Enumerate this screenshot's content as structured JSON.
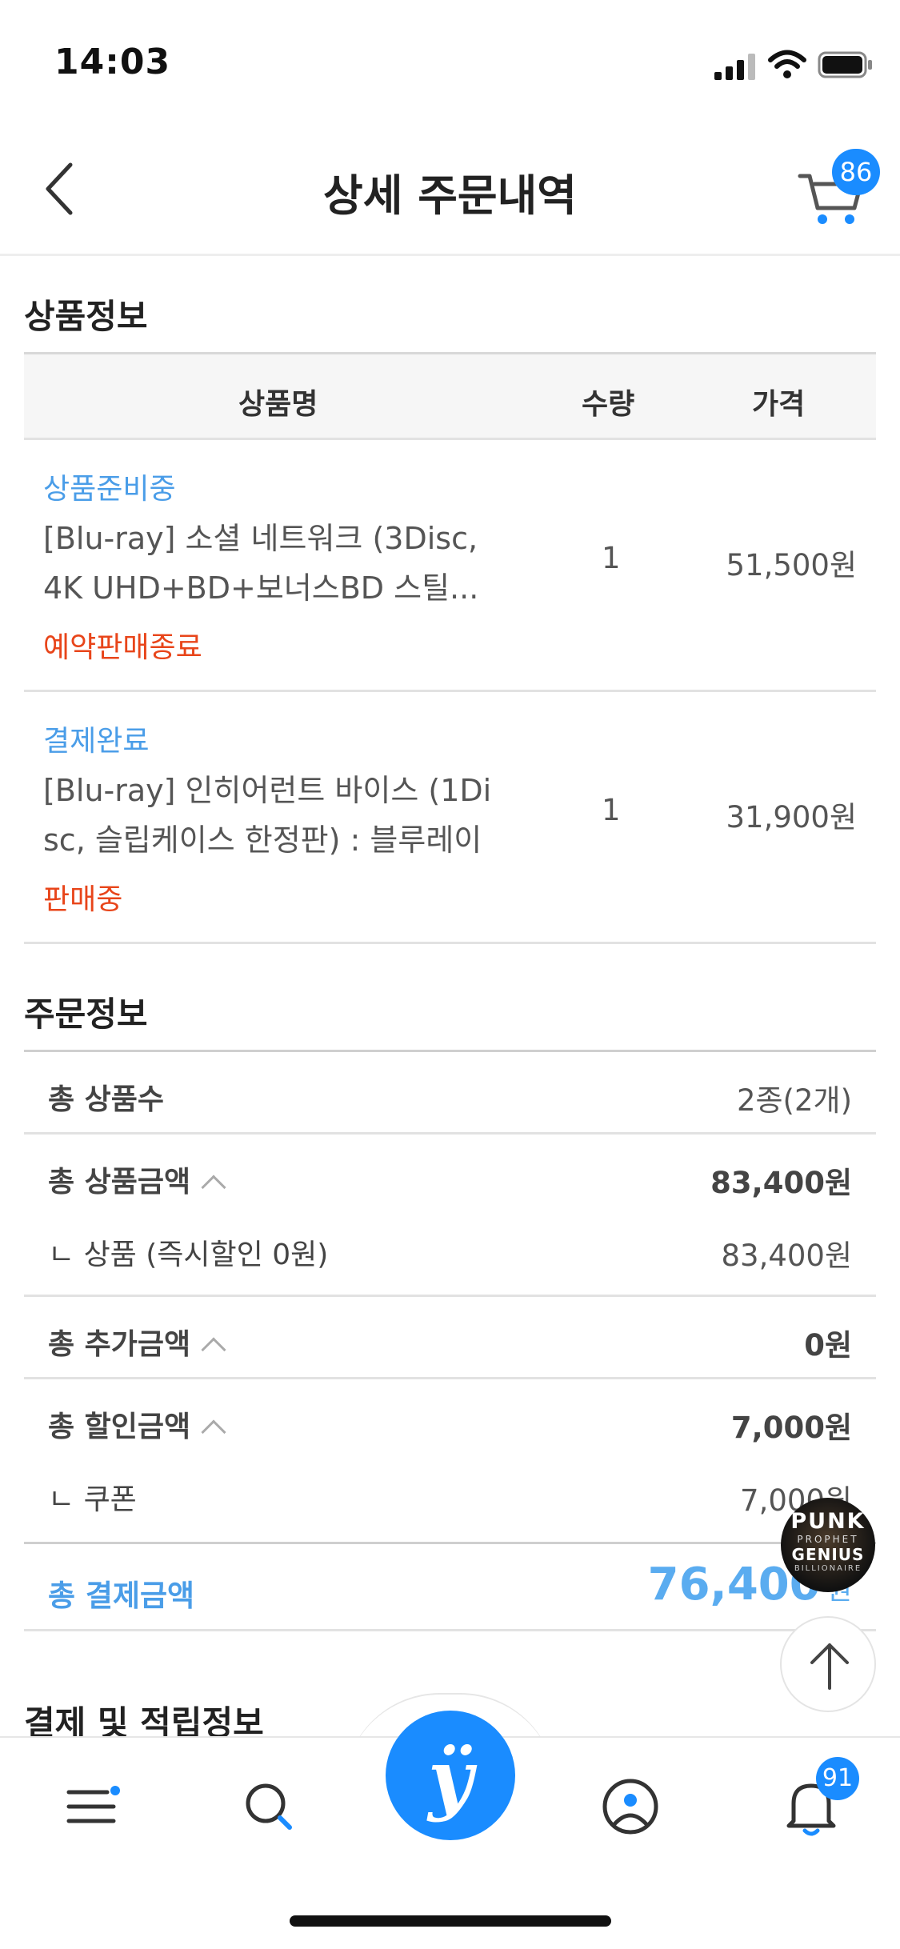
{
  "status_bar": {
    "time": "14:03"
  },
  "header": {
    "title": "상세 주문내역",
    "cart_count": "86"
  },
  "product_section": {
    "title": "상품정보",
    "columns": [
      "상품명",
      "수량",
      "가격"
    ],
    "items": [
      {
        "status": "상품준비중",
        "name_line1": "[Blu-ray] 소셜 네트워크 (3Disc,",
        "name_line2": "4K UHD+BD+보너스BD 스틸...",
        "sale_status": "예약판매종료",
        "qty": "1",
        "price": "51,500원"
      },
      {
        "status": "결제완료",
        "name_line1": "[Blu-ray] 인히어런트 바이스 (1Di",
        "name_line2": "sc, 슬립케이스 한정판) : 블루레이",
        "sale_status": "판매중",
        "qty": "1",
        "price": "31,900원"
      }
    ]
  },
  "order_section": {
    "title": "주문정보",
    "total_items_label": "총 상품수",
    "total_items_value": "2종(2개)",
    "product_amount_label": "총 상품금액",
    "product_amount_value": "83,400원",
    "product_sub_label": "ㄴ 상품 (즉시할인 0원)",
    "product_sub_value": "83,400원",
    "extra_amount_label": "총 추가금액",
    "extra_amount_value": "0원",
    "discount_label": "총 할인금액",
    "discount_value": "7,000원",
    "coupon_label": "ㄴ 쿠폰",
    "coupon_value": "7,000원",
    "payment_label": "총 결제금액",
    "payment_value": "76,400",
    "payment_unit": "원"
  },
  "pay_section": {
    "title": "결제 및 적립정보"
  },
  "floating": {
    "ad_line1": "PUNK",
    "ad_line2": "PROPHET",
    "ad_line3": "GENIUS",
    "ad_line4": "BILLIONAIRE"
  },
  "tabbar": {
    "center_logo": "ÿ",
    "notification_count": "91"
  }
}
